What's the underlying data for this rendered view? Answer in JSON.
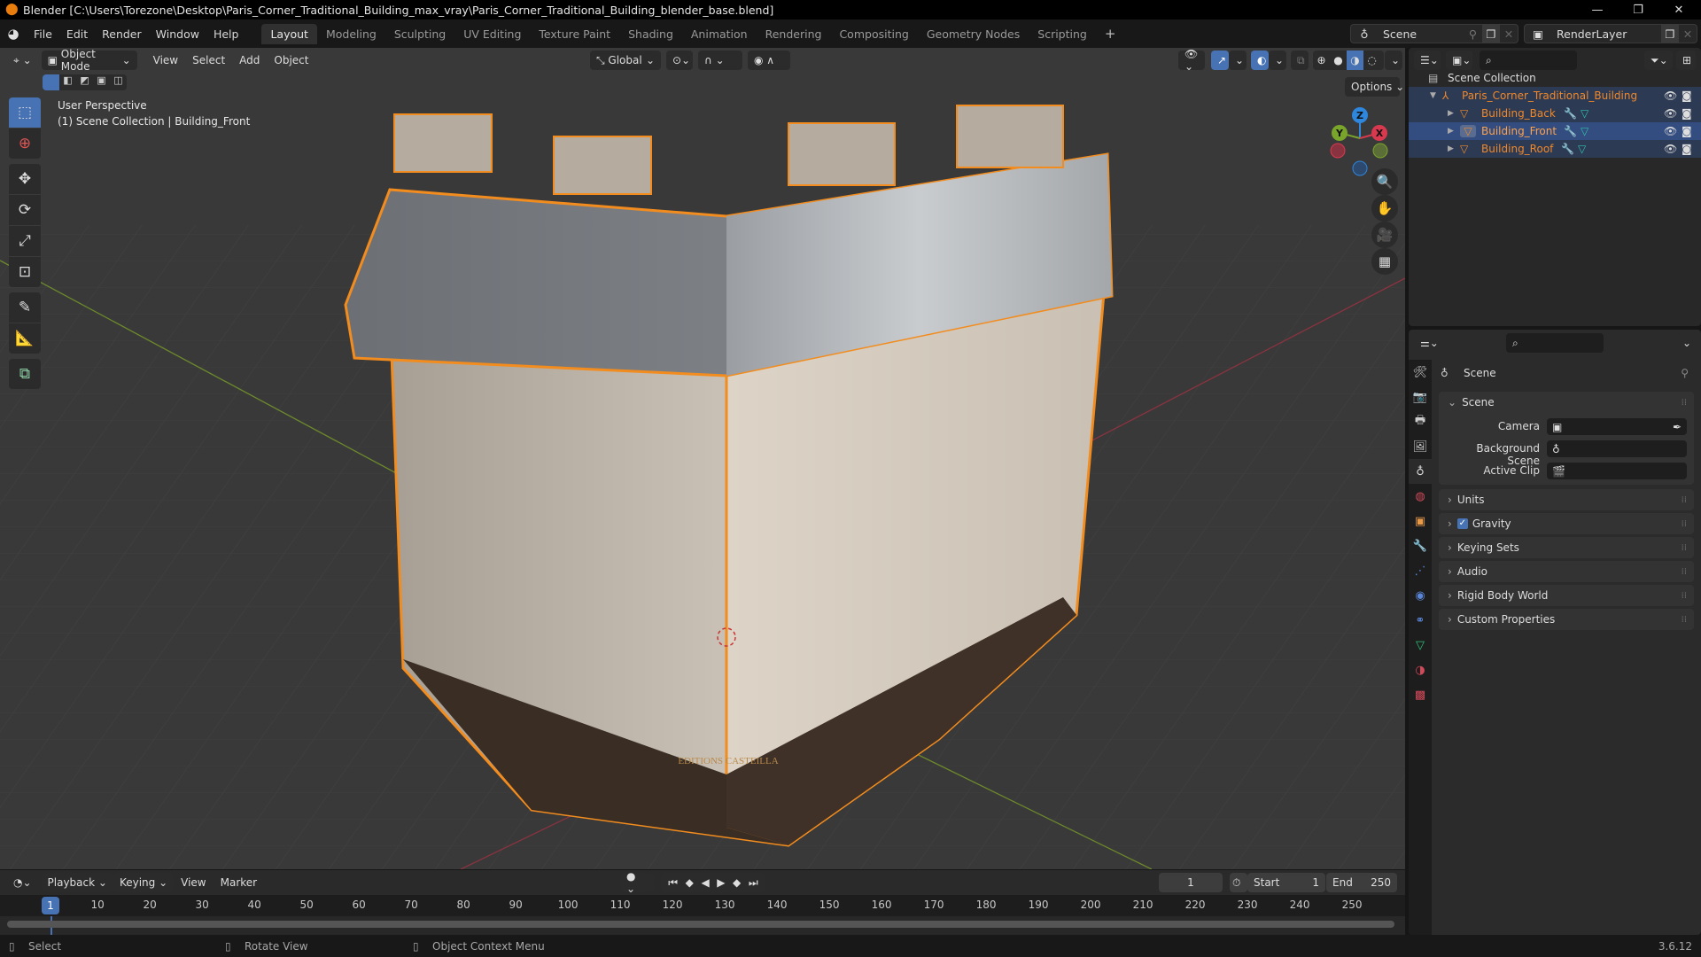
{
  "window": {
    "title": "Blender [C:\\Users\\Torezone\\Desktop\\Paris_Corner_Traditional_Building_max_vray\\Paris_Corner_Traditional_Building_blender_base.blend]",
    "controls": {
      "minimize": "—",
      "maximize": "❐",
      "close": "✕"
    }
  },
  "menubar": {
    "menus": [
      "File",
      "Edit",
      "Render",
      "Window",
      "Help"
    ],
    "workspaces": [
      "Layout",
      "Modeling",
      "Sculpting",
      "UV Editing",
      "Texture Paint",
      "Shading",
      "Animation",
      "Rendering",
      "Compositing",
      "Geometry Nodes",
      "Scripting"
    ],
    "active_workspace": "Layout",
    "add_workspace": "+",
    "scene": "Scene",
    "view_layer": "RenderLayer"
  },
  "viewport": {
    "mode": "Object Mode",
    "menus": [
      "View",
      "Select",
      "Add",
      "Object"
    ],
    "transform_orientation": "Global",
    "options_label": "Options",
    "overlay_line1": "User Perspective",
    "overlay_line2": "(1) Scene Collection | Building_Front",
    "gizmo_axes": {
      "x": "X",
      "y": "Y",
      "z": "Z"
    },
    "axis_colors": {
      "x": "#d8394f",
      "y": "#7aa52b",
      "z": "#2e86dd"
    },
    "selection_outline_color": "#f28c1e",
    "shop_sign": "EDITIONS CASTEILLA",
    "tools": [
      "select-box",
      "cursor",
      "move",
      "rotate",
      "scale",
      "transform",
      "annotate",
      "measure",
      "add-cube"
    ]
  },
  "outliner": {
    "root": "Scene Collection",
    "items": [
      {
        "name": "Paris_Corner_Traditional_Building",
        "type": "empty",
        "level": 1,
        "expanded": true
      },
      {
        "name": "Building_Back",
        "type": "mesh",
        "level": 2
      },
      {
        "name": "Building_Front",
        "type": "mesh",
        "level": 2,
        "active": true
      },
      {
        "name": "Building_Roof",
        "type": "mesh",
        "level": 2
      }
    ]
  },
  "properties": {
    "context": "Scene",
    "scene_panel": {
      "title": "Scene",
      "fields": [
        {
          "label": "Camera",
          "value": ""
        },
        {
          "label": "Background Scene",
          "value": ""
        },
        {
          "label": "Active Clip",
          "value": ""
        }
      ]
    },
    "collapsed_panels": [
      "Units",
      "Gravity",
      "Keying Sets",
      "Audio",
      "Rigid Body World",
      "Custom Properties"
    ],
    "gravity_enabled": true
  },
  "timeline": {
    "menus": [
      "Playback",
      "Keying",
      "View",
      "Marker"
    ],
    "current_frame": "1",
    "start_label": "Start",
    "start": "1",
    "end_label": "End",
    "end": "250",
    "ticks": [
      "10",
      "20",
      "30",
      "40",
      "50",
      "60",
      "70",
      "80",
      "90",
      "100",
      "110",
      "120",
      "130",
      "140",
      "150",
      "160",
      "170",
      "180",
      "190",
      "200",
      "210",
      "220",
      "230",
      "240",
      "250"
    ],
    "playhead": "1"
  },
  "statusbar": {
    "hints": [
      "Select",
      "Rotate View",
      "Object Context Menu"
    ],
    "version": "3.6.12"
  }
}
